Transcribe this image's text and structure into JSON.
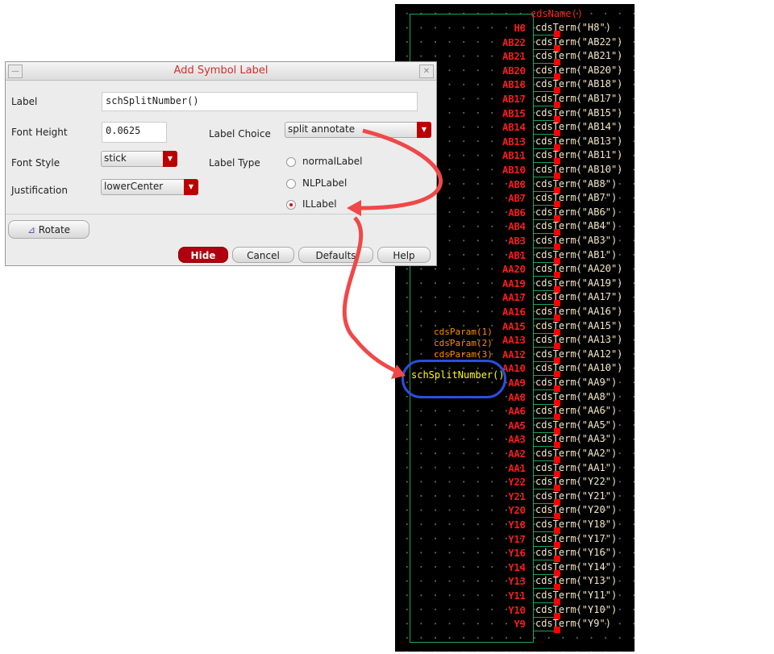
{
  "dialog": {
    "title": "Add Symbol Label",
    "label_caption": "Label",
    "label_value": "schSplitNumber()",
    "font_height_caption": "Font Height",
    "font_height_value": "0.0625",
    "font_style_caption": "Font Style",
    "font_style_value": "stick",
    "justification_caption": "Justification",
    "justification_value": "lowerCenter",
    "label_choice_caption": "Label Choice",
    "label_choice_value": "split annotate",
    "label_type_caption": "Label Type",
    "label_types": [
      {
        "label": "normalLabel",
        "selected": false
      },
      {
        "label": "NLPLabel",
        "selected": false
      },
      {
        "label": "ILLabel",
        "selected": true
      }
    ],
    "rotate_label": "Rotate",
    "hide_label": "Hide",
    "cancel_label": "Cancel",
    "defaults_label": "Defaults",
    "help_label": "Help"
  },
  "schematic": {
    "cds_name": "cdsName()",
    "params": [
      "cdsParam(1)",
      "cdsParam(2)",
      "cdsParam(3)"
    ],
    "split_label": "schSplitNumber()",
    "pins": [
      "H8",
      "AB22",
      "AB21",
      "AB20",
      "AB18",
      "AB17",
      "AB15",
      "AB14",
      "AB13",
      "AB11",
      "AB10",
      "AB8",
      "AB7",
      "AB6",
      "AB4",
      "AB3",
      "AB1",
      "AA20",
      "AA19",
      "AA17",
      "AA16",
      "AA15",
      "AA13",
      "AA12",
      "AA10",
      "AA9",
      "AA8",
      "AA6",
      "AA5",
      "AA3",
      "AA2",
      "AA1",
      "Y22",
      "Y21",
      "Y20",
      "Y18",
      "Y17",
      "Y16",
      "Y14",
      "Y13",
      "Y11",
      "Y10",
      "Y9"
    ]
  },
  "colors": {
    "annotation_arrow": "#f04848",
    "highlight_ellipse": "#2b4fe0"
  }
}
